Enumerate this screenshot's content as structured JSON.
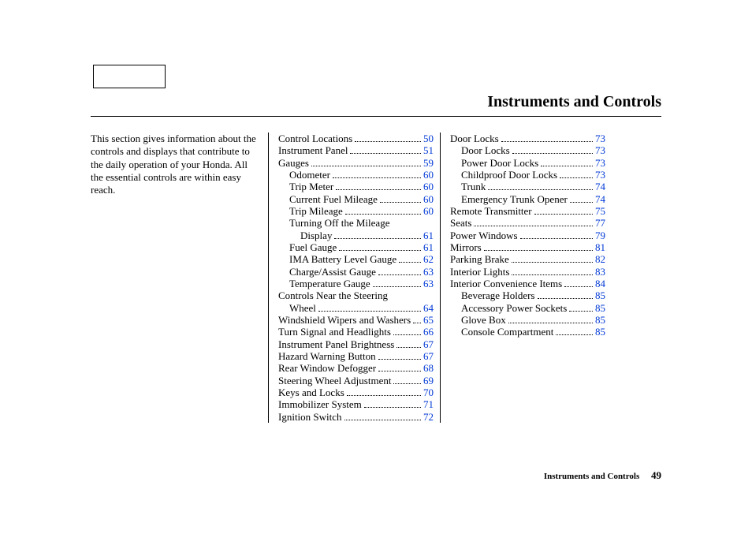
{
  "title": "Instruments and Controls",
  "intro": "This section gives information about the controls and displays that contribute to the daily operation of your Honda. All the essential controls are within easy reach.",
  "footer": {
    "label": "Instruments and Controls",
    "page": "49"
  },
  "columns": [
    [
      {
        "label": "Control Locations",
        "page": "50",
        "indent": 0
      },
      {
        "label": "Instrument Panel",
        "page": "51",
        "indent": 0
      },
      {
        "label": "Gauges",
        "page": "59",
        "indent": 0
      },
      {
        "label": "Odometer",
        "page": "60",
        "indent": 1
      },
      {
        "label": "Trip Meter",
        "page": "60",
        "indent": 1
      },
      {
        "label": "Current Fuel Mileage",
        "page": "60",
        "indent": 1
      },
      {
        "label": "Trip Mileage",
        "page": "60",
        "indent": 1
      },
      {
        "label": "Turning Off the Mileage",
        "page": "",
        "indent": 1,
        "noDots": true
      },
      {
        "label": "Display",
        "page": "61",
        "indent": 2
      },
      {
        "label": "Fuel Gauge",
        "page": "61",
        "indent": 1
      },
      {
        "label": "IMA Battery Level Gauge",
        "page": "62",
        "indent": 1
      },
      {
        "label": "Charge/Assist Gauge",
        "page": "63",
        "indent": 1
      },
      {
        "label": "Temperature Gauge",
        "page": "63",
        "indent": 1
      },
      {
        "label": "Controls Near the Steering",
        "page": "",
        "indent": 0,
        "noDots": true
      },
      {
        "label": "Wheel",
        "page": "64",
        "indent": 1
      },
      {
        "label": "Windshield Wipers and Washers",
        "page": "65",
        "indent": 0
      },
      {
        "label": "Turn Signal and Headlights",
        "page": "66",
        "indent": 0
      },
      {
        "label": "Instrument Panel Brightness",
        "page": "67",
        "indent": 0
      },
      {
        "label": "Hazard Warning Button",
        "page": "67",
        "indent": 0
      },
      {
        "label": "Rear Window Defogger",
        "page": "68",
        "indent": 0
      },
      {
        "label": "Steering Wheel Adjustment",
        "page": "69",
        "indent": 0
      },
      {
        "label": "Keys and Locks",
        "page": "70",
        "indent": 0
      },
      {
        "label": "Immobilizer System",
        "page": "71",
        "indent": 0
      },
      {
        "label": "Ignition Switch",
        "page": "72",
        "indent": 0
      }
    ],
    [
      {
        "label": "Door Locks",
        "page": "73",
        "indent": 0
      },
      {
        "label": "Door Locks",
        "page": "73",
        "indent": 1
      },
      {
        "label": "Power Door Locks",
        "page": "73",
        "indent": 1
      },
      {
        "label": "Childproof Door Locks",
        "page": "73",
        "indent": 1
      },
      {
        "label": "Trunk",
        "page": "74",
        "indent": 1
      },
      {
        "label": "Emergency Trunk Opener",
        "page": "74",
        "indent": 1
      },
      {
        "label": "Remote Transmitter",
        "page": "75",
        "indent": 0
      },
      {
        "label": "Seats",
        "page": "77",
        "indent": 0
      },
      {
        "label": "Power Windows",
        "page": "79",
        "indent": 0
      },
      {
        "label": "Mirrors",
        "page": "81",
        "indent": 0
      },
      {
        "label": "Parking Brake",
        "page": "82",
        "indent": 0
      },
      {
        "label": "Interior Lights",
        "page": "83",
        "indent": 0
      },
      {
        "label": "Interior Convenience Items",
        "page": "84",
        "indent": 0
      },
      {
        "label": "Beverage Holders",
        "page": "85",
        "indent": 1
      },
      {
        "label": "Accessory Power Sockets",
        "page": "85",
        "indent": 1
      },
      {
        "label": "Glove Box",
        "page": "85",
        "indent": 1
      },
      {
        "label": "Console Compartment",
        "page": "85",
        "indent": 1
      }
    ]
  ]
}
